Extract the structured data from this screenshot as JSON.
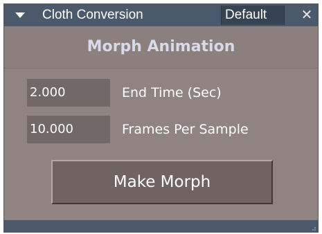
{
  "window": {
    "title": "Cloth Conversion",
    "preset": "Default",
    "close_glyph": "✕"
  },
  "section": {
    "title": "Morph Animation"
  },
  "fields": [
    {
      "value": "2.000",
      "label": "End Time (Sec)"
    },
    {
      "value": "10.000",
      "label": "Frames Per Sample"
    }
  ],
  "actions": {
    "make_morph_label": "Make Morph"
  },
  "icons": {
    "collapse": "collapse-arrow-icon",
    "close": "close-icon",
    "resize": "resize-grip-icon"
  }
}
